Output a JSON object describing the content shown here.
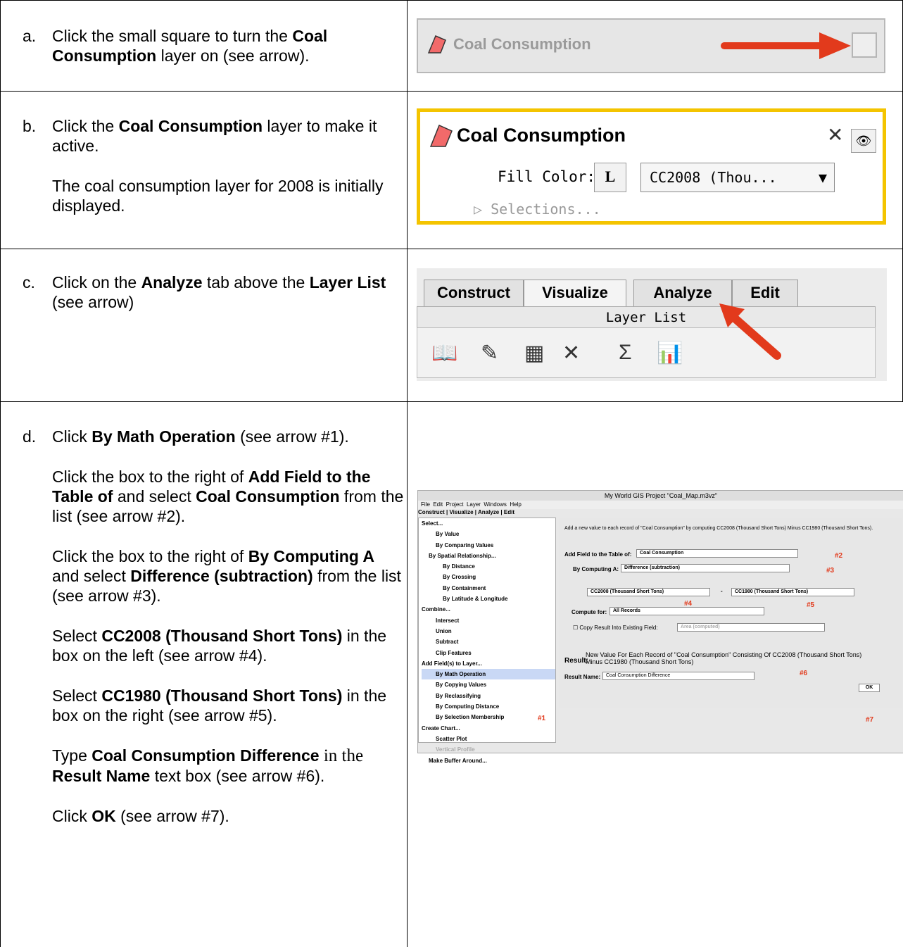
{
  "rows": [
    {
      "label": "a.",
      "paragraphs": [
        [
          "Click the small square to turn the ",
          "Coal Consumption",
          " layer on (see arrow)."
        ]
      ]
    },
    {
      "label": "b.",
      "paragraphs": [
        [
          "Click the ",
          "Coal Consumption",
          " layer to make it active."
        ],
        [
          "The coal consumption layer for 2008 is initially displayed."
        ]
      ]
    },
    {
      "label": "c.",
      "paragraphs": [
        [
          "Click on the ",
          "Analyze",
          " tab above the ",
          "Layer List",
          " (see arrow)"
        ]
      ]
    },
    {
      "label": "d.",
      "p1": [
        "Click ",
        "By Math Operation",
        " (see arrow #1)."
      ],
      "p2": [
        "Click the box to the right of ",
        "Add Field to the Table of",
        " and select ",
        "Coal Consumption",
        " from the list (see arrow #2)."
      ],
      "p3": [
        "Click the box to the right of ",
        "By Computing A",
        " and select ",
        "Difference (subtraction)",
        " from the list (see arrow #3)."
      ],
      "p4": [
        "Select ",
        "CC2008 (Thousand Short Tons)",
        " in the box on the left (see arrow #4)."
      ],
      "p5": [
        "Select ",
        "CC1980 (Thousand Short Tons)",
        " in the box on the right (see arrow #5)."
      ],
      "p6": [
        "Type ",
        "Coal Consumption Difference",
        " in the ",
        "Result Name",
        " text box (see arrow #6)."
      ],
      "p7": [
        "Click ",
        "OK",
        " (see arrow #7)."
      ]
    }
  ],
  "panel_a": {
    "layer": "Coal Consumption"
  },
  "panel_b": {
    "layer": "Coal Consumption",
    "fill_label": "Fill Color:",
    "select": "CC2008 (Thou...",
    "selections": "Selections..."
  },
  "panel_c": {
    "tabs": [
      "Construct",
      "Visualize",
      "Analyze",
      "Edit"
    ],
    "layer_list": "Layer List"
  },
  "panel_d": {
    "window_title": "My World GIS Project \"Coal_Map.m3vz\"",
    "menu": [
      "File",
      "Edit",
      "Project",
      "Layer",
      "Windows",
      "Help"
    ],
    "tabs": [
      "Construct",
      "Visualize",
      "Analyze",
      "Edit"
    ],
    "tree": [
      "Select...",
      "By Value",
      "By Comparing Values",
      "By Spatial Relationship...",
      "By Distance",
      "By Crossing",
      "By Containment",
      "By Latitude & Longitude",
      "Combine...",
      "Intersect",
      "Union",
      "Subtract",
      "Clip Features",
      "Add Field(s) to Layer...",
      "By Math Operation",
      "By Copying Values",
      "By Reclassifying",
      "By Computing Distance",
      "By Selection Membership",
      "Create Chart...",
      "Scatter Plot",
      "Vertical Profile",
      "Make Buffer Around..."
    ],
    "description": "Add a new value to each record of \"Coal Consumption\" by computing CC2008 (Thousand Short Tons) Minus CC1980 (Thousand Short Tons).",
    "add_field_label": "Add Field to the Table of:",
    "add_field_value": "Coal Consumption",
    "compute_label": "By Computing A:",
    "compute_value": "Difference (subtraction)",
    "left_field": "CC2008 (Thousand Short Tons)",
    "minus": "-",
    "right_field": "CC1980 (Thousand Short Tons)",
    "compute_for_label": "Compute for:",
    "compute_for_value": "All Records",
    "copy_label": "Copy Result Into Existing Field:",
    "copy_value": "Area (computed)",
    "result_label": "Result:",
    "result_text": "New Value For Each Record of \"Coal Consumption\" Consisting Of CC2008 (Thousand Short Tons) Minus CC1980 (Thousand Short Tons)",
    "result_name_label": "Result Name:",
    "result_name_value": "Coal Consumption Difference",
    "ok": "OK",
    "arrows": [
      "#1",
      "#2",
      "#3",
      "#4",
      "#5",
      "#6",
      "#7"
    ]
  }
}
